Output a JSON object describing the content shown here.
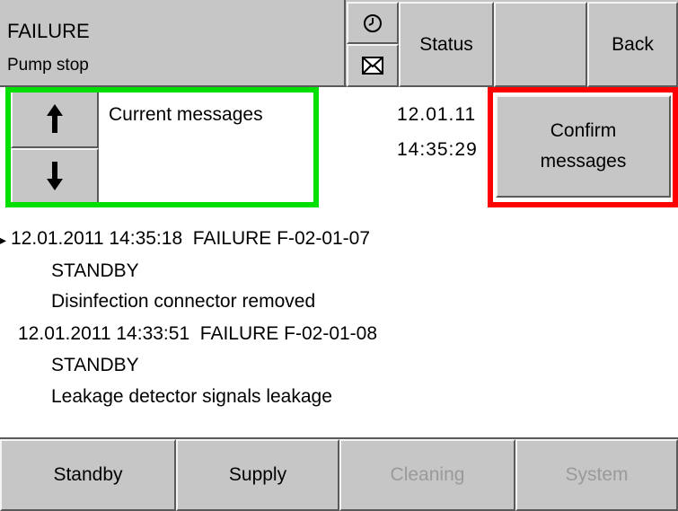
{
  "header": {
    "title": "FAILURE",
    "subtitle": "Pump stop",
    "clock_icon": "clock-icon",
    "mail_icon": "envelope-icon",
    "status_label": "Status",
    "back_label": "Back"
  },
  "messages": {
    "heading": "Current messages",
    "date": "12.01.11",
    "time": "14:35:29",
    "up_icon": "arrow-up-icon",
    "down_icon": "arrow-down-icon",
    "confirm_label": "Confirm messages",
    "entries": [
      {
        "line1": "12.01.2011 14:35:18  FAILURE F-02-01-07",
        "line2": "STANDBY",
        "line3": "Disinfection connector removed"
      },
      {
        "line1": "12.01.2011 14:33:51  FAILURE F-02-01-08",
        "line2": "STANDBY",
        "line3": "Leakage detector signals leakage"
      }
    ]
  },
  "footer": {
    "tabs": [
      "Standby",
      "Supply",
      "Cleaning",
      "System"
    ]
  },
  "colors": {
    "panel_gray": "#c6c6c6",
    "highlight_green": "#00e000",
    "highlight_red": "#ff0000"
  }
}
